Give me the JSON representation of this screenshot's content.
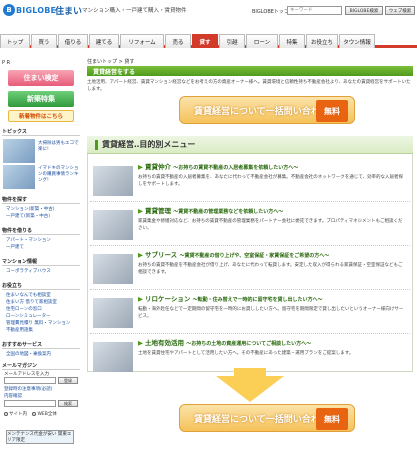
{
  "header": {
    "logo_text": "BIGLOBE",
    "site_name": "住まい",
    "site_sub": "マンション購入・一戸建て購入・賃貸物件",
    "top_link": "BIGLOBEトップ",
    "search_placeholder": "キーワード",
    "search_button": "BIGLOBE検索",
    "web_button": "ウェブ検索"
  },
  "nav": {
    "tabs": [
      {
        "label": "トップ",
        "active": false
      },
      {
        "label": "買う",
        "active": false
      },
      {
        "label": "借りる",
        "active": false
      },
      {
        "label": "建てる",
        "active": false
      },
      {
        "label": "リフォーム",
        "active": false
      },
      {
        "label": "売る",
        "active": false
      },
      {
        "label": "貸す",
        "active": true
      },
      {
        "label": "引越",
        "active": false
      },
      {
        "label": "ローン",
        "active": false
      },
      {
        "label": "特集",
        "active": false
      },
      {
        "label": "お役立ち",
        "active": false
      },
      {
        "label": "タウン情報",
        "active": false
      }
    ]
  },
  "sidebar": {
    "pr": "P R",
    "banners": [
      "住まい検定",
      "新築特集",
      "新着物件はこちら"
    ],
    "topics_title": "トピックス",
    "topics": [
      "大掃除は男もエコで楽に!",
      "イマドキのマンションの購買事情ランキング!"
    ],
    "buy_title": "物件を探す",
    "buy_links": [
      "マンション(新築・中古)",
      "一戸建て(新築・中古)"
    ],
    "rent_title": "物件を借りる",
    "rent_links": [
      "アパート・マンション",
      "一戸建て"
    ],
    "mansion_title": "マンション情報",
    "mansion_links": [
      "コーポラティブハウス"
    ],
    "useful_title": "お役立ち",
    "useful_links": [
      "住まいなんでも相談室",
      "住まい方 借りて家相談室",
      "住宅ローンの窓口",
      "ローンシミュレーター",
      "管理費見積り 無料・マンション",
      "不動産用語集"
    ],
    "service_title": "おすすめサービス",
    "service_links": [
      "全国の地図・乗換案内"
    ],
    "mail_title": "メールマガジン",
    "mail_label": "メールアドレスを入力",
    "mail_register": "登録",
    "mail_desc": "登録時の注意事項(必読)",
    "mail_sub": "内容確認",
    "radio_site": "サイト内",
    "radio_web": "WEB全体",
    "search_btn": "検索",
    "ad": "メンテナンス代金が安い 関東エリア限定"
  },
  "main": {
    "breadcrumb": "住まいトップ > 貸す",
    "title": "賃貸経営をする",
    "intro": "土地活用、アパート経営、賃貸マンション経営などをお考えの方の資産オーナー様へ。賃貸環境と信頼性持ち不動産会社より、あなたの賃貸経営をサポートいたします。",
    "cta_text": "賃貸経営について一括問い合わせする",
    "cta_badge": "無料",
    "menu_title": "賃貸経営‥目的別メニュー",
    "items": [
      {
        "title": "賃貸仲介",
        "sub": "～お持ちの賃貸不動産の入居者募集を依頼したい方へ～",
        "desc": "お持ちの賃貸不動産の入居者募集を、あなたに代わって不動産会社が募集。不動産会社のネットワークを通じて、効率的な入居者探しをサポートします。"
      },
      {
        "title": "賃貸管理",
        "sub": "～賃貸不動産の管理業務などを依頼したい方へ～",
        "desc": "家賃集金や修繕対応など、お持ちの賃貸不動産の管理業務をパートナー会社に委託できます。プロパティマネジメントもご相談ください。"
      },
      {
        "title": "サブリース",
        "sub": "～賃貸不動産の借り上げや、空室保証・家賃保証をご希望の方へ～",
        "desc": "お持ちの賃貸不動産を不動産会社が借り上げ、あなたに代わって転貸します。安定した収入が得られる家賃保証・空室保証などもご相談できます。"
      },
      {
        "title": "リロケーション",
        "sub": "～転勤・住み替えで一時的に留守宅を貸し出したい方へ～",
        "desc": "転勤・海外赴任などで一定期間の留守宅を一時的にお貸ししたい方へ。留守宅を期間限定で貸し出したいというオーナー様向けサービス。"
      },
      {
        "title": "土地有効活用",
        "sub": "～お持ちの土地の資産運用についてご相談したい方へ～",
        "desc": "土地を賃貸住宅やアパートとして活用したい方へ。その不動産にあった建築・運用プランをご提案します。"
      }
    ]
  }
}
